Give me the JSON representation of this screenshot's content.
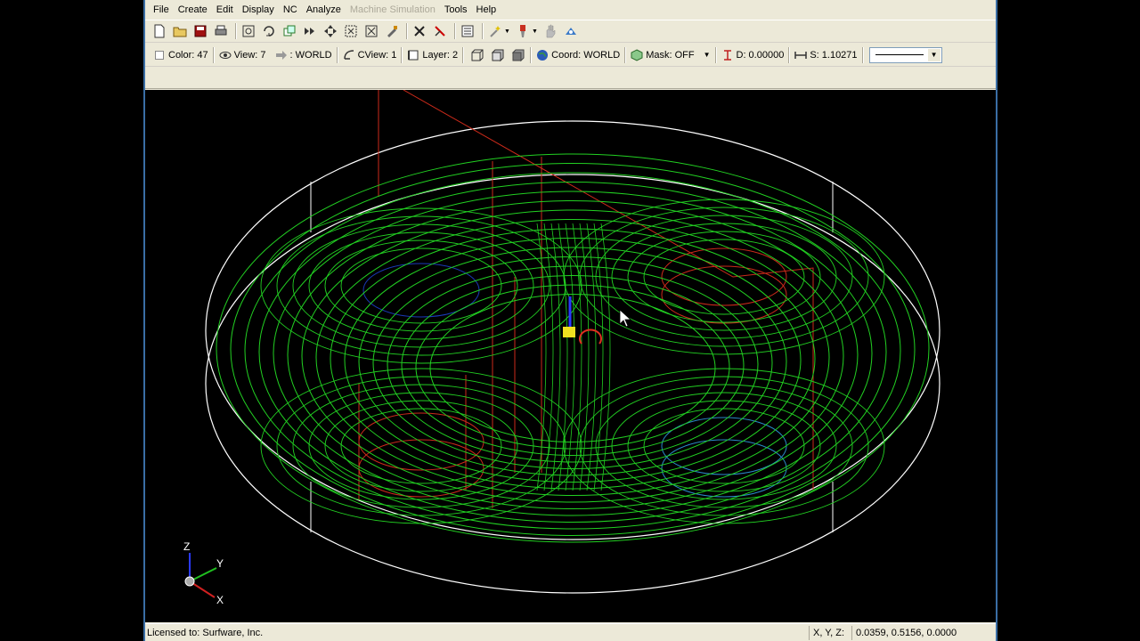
{
  "menu": [
    "File",
    "Create",
    "Edit",
    "Display",
    "NC",
    "Analyze",
    "Machine Simulation",
    "Tools",
    "Help"
  ],
  "menu_disabled": {
    "Machine Simulation": true
  },
  "toolbar2": {
    "color": "Color: 47",
    "view": "View: 7",
    "world": ": WORLD",
    "cview": "CView: 1",
    "layer": "Layer: 2",
    "coord": "Coord: WORLD",
    "mask": "Mask: OFF",
    "depth": "D: 0.00000",
    "scale": "S: 1.10271"
  },
  "axes": {
    "z": "Z",
    "y": "Y",
    "x": "X"
  },
  "status": {
    "license": "Licensed to: Surfware, Inc.",
    "coord_label": "X, Y, Z:",
    "coord_value": "0.0359, 0.5156, 0.0000"
  },
  "colors": {
    "toolpath": "#22d022",
    "stock": "#ffffff",
    "feature": "#cc2a1a",
    "background": "#000000"
  }
}
